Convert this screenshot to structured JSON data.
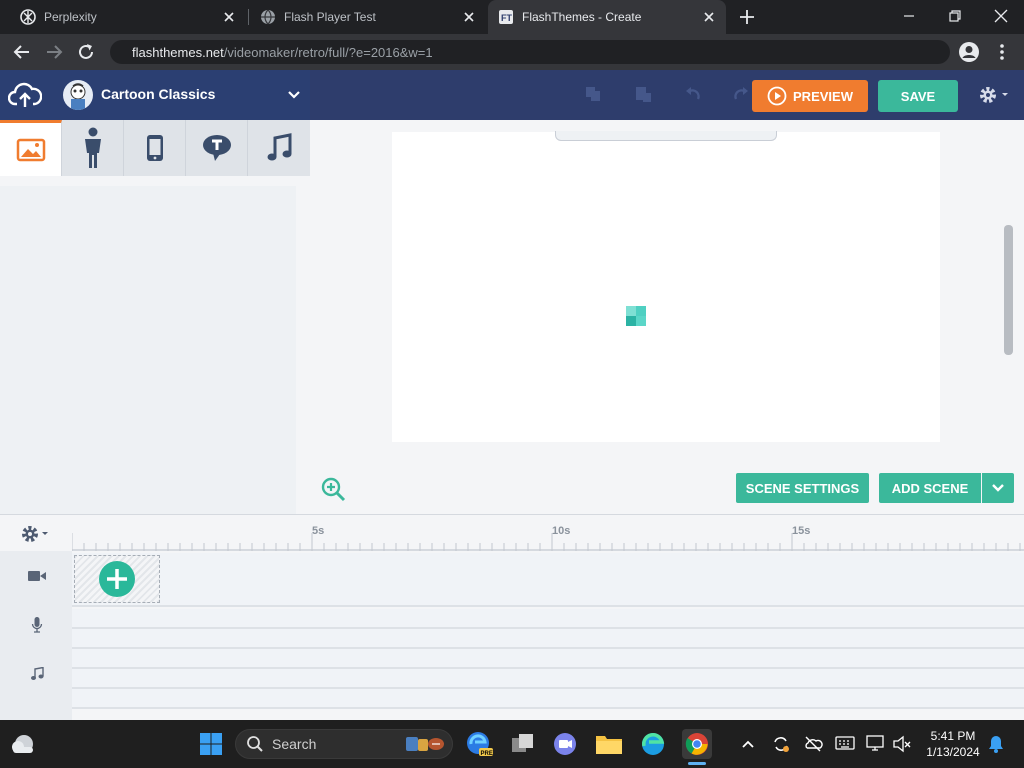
{
  "browser": {
    "tabs": [
      {
        "title": "Perplexity",
        "active": false
      },
      {
        "title": "Flash Player Test",
        "active": false
      },
      {
        "title": "FlashThemes - Create",
        "active": true
      }
    ],
    "url_host": "flashthemes.net",
    "url_path": "/videomaker/retro/full/?e=2016&w=1"
  },
  "app": {
    "theme_name": "Cartoon Classics",
    "preview_label": "PREVIEW",
    "save_label": "SAVE",
    "panel_tabs": [
      {
        "name": "backgrounds",
        "icon": "image-icon",
        "active": true
      },
      {
        "name": "characters",
        "icon": "person-icon",
        "active": false
      },
      {
        "name": "props",
        "icon": "phone-icon",
        "active": false
      },
      {
        "name": "text",
        "icon": "speech-bubble-icon",
        "active": false
      },
      {
        "name": "sounds",
        "icon": "music-note-icon",
        "active": false
      }
    ],
    "scene_settings_label": "SCENE SETTINGS",
    "add_scene_label": "ADD SCENE",
    "accent_colors": {
      "orange": "#f07c2f",
      "teal": "#3bb89b",
      "navy": "#2e3d6c"
    }
  },
  "timeline": {
    "ticks": [
      "5s",
      "10s",
      "15s"
    ],
    "tracks": [
      {
        "name": "video",
        "icon": "video-camera-icon"
      },
      {
        "name": "voice",
        "icon": "microphone-icon"
      },
      {
        "name": "music",
        "icon": "music-note-icon"
      }
    ]
  },
  "taskbar": {
    "search_label": "Search",
    "time": "5:41 PM",
    "date": "1/13/2024"
  }
}
